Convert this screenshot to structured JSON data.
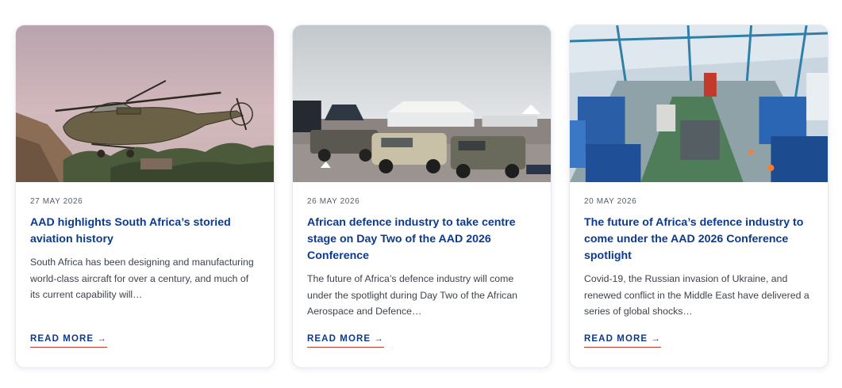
{
  "cards": [
    {
      "image": "attack-helicopter-photo",
      "date": "27 MAY 2026",
      "title": "AAD highlights South Africa’s storied aviation history",
      "excerpt": "South Africa has been designing and manufacturing world-class aircraft for over a century, and much of its current capability will…",
      "read_more": "READ MORE",
      "arrow": "→"
    },
    {
      "image": "armoured-vehicles-exhibition-photo",
      "date": "26 MAY 2026",
      "title": "African defence industry to take centre stage on Day Two of the AAD 2026 Conference",
      "excerpt": "The future of Africa’s defence industry will come under the spotlight during Day Two of the African Aerospace and Defence…",
      "read_more": "READ MORE",
      "arrow": "→"
    },
    {
      "image": "factory-floor-photo",
      "date": "20 MAY 2026",
      "title": "The future of Africa’s defence industry to come under the AAD 2026 Conference spotlight",
      "excerpt": "Covid-19, the Russian invasion of Ukraine, and renewed conflict in the Middle East have delivered a series of global shocks…",
      "read_more": "READ MORE",
      "arrow": "→"
    }
  ],
  "colors": {
    "title": "#0c3a8c",
    "underline": "#c0392b",
    "text": "#3e434c"
  }
}
